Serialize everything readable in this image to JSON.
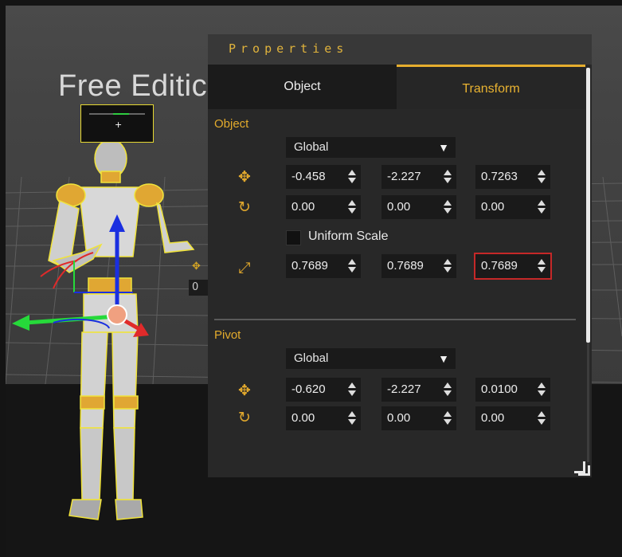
{
  "viewport": {
    "edition_label": "Free Editic",
    "mini_field_value": "0"
  },
  "panel": {
    "title": "Properties",
    "tabs": [
      {
        "label": "Object",
        "active": false
      },
      {
        "label": "Transform",
        "active": true
      }
    ],
    "object_section": {
      "title": "Object",
      "space": "Global",
      "position": [
        "-0.458",
        "-2.227",
        "0.7263"
      ],
      "rotation": [
        "0.00",
        "0.00",
        "0.00"
      ],
      "uniform_scale_label": "Uniform Scale",
      "uniform_scale_checked": false,
      "scale": [
        "0.7689",
        "0.7689",
        "0.7689"
      ]
    },
    "pivot_section": {
      "title": "Pivot",
      "space": "Global",
      "position": [
        "-0.620",
        "-2.227",
        "0.0100"
      ],
      "rotation": [
        "0.00",
        "0.00",
        "0.00"
      ]
    }
  },
  "icons": {
    "move": "move-icon",
    "rotate": "rotate-icon",
    "scale": "scale-icon",
    "dropdown": "chevron-down-icon"
  },
  "colors": {
    "accent": "#e3ab2c",
    "selection_outline": "#c52828",
    "gizmo_x": "#26d93a",
    "gizmo_y": "#1a2fe0",
    "gizmo_z": "#e02a2a",
    "outline": "#f0e33a"
  }
}
